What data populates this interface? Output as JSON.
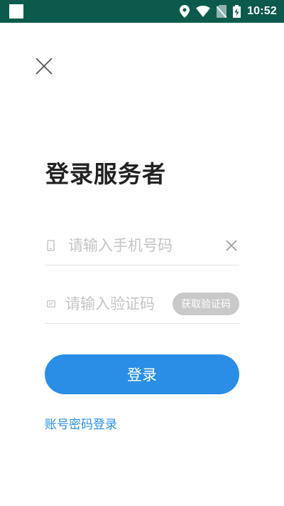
{
  "status_bar": {
    "time": "10:52",
    "icons": [
      "location-icon",
      "wifi-icon",
      "no-sim-icon",
      "battery-charging-icon"
    ],
    "background": "#0b5a4b"
  },
  "header": {
    "close_icon": "close-icon"
  },
  "main": {
    "title": "登录服务者",
    "phone_field": {
      "icon": "phone-icon",
      "placeholder": "请输入手机号码",
      "value": "",
      "clear_icon": "clear-icon"
    },
    "code_field": {
      "icon": "sms-code-icon",
      "placeholder": "请输入验证码",
      "value": "",
      "get_code_label": "获取验证码"
    },
    "login_label": "登录",
    "alt_login_label": "账号密码登录"
  },
  "colors": {
    "accent": "#2a8ee6",
    "disabled_button": "#c9c9c9",
    "title_text": "#222222",
    "placeholder": "#c4c4c4"
  }
}
